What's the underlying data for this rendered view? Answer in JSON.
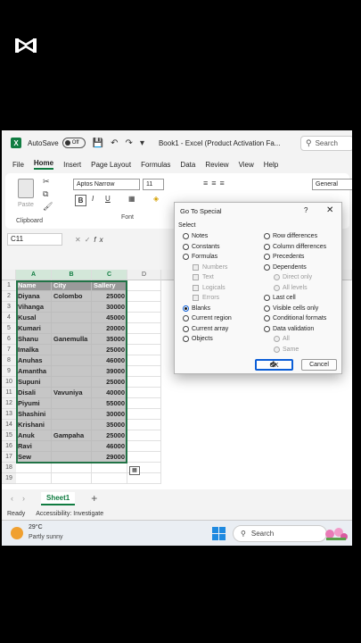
{
  "titlebar": {
    "autosave_label": "AutoSave",
    "autosave_state": "Off",
    "doc_title": "Book1 - Excel (Product Activation Fa...",
    "search_placeholder": "Search"
  },
  "menu": [
    "File",
    "Home",
    "Insert",
    "Page Layout",
    "Formulas",
    "Data",
    "Review",
    "View",
    "Help"
  ],
  "active_menu": "Home",
  "ribbon": {
    "paste_label": "Paste",
    "clipboard_label": "Clipboard",
    "font_name": "Aptos Narrow",
    "font_size": "11",
    "font_label": "Font",
    "bold": "B",
    "italic": "I",
    "underline": "U",
    "number_format": "General"
  },
  "formula": {
    "namebox": "C11",
    "fx": "fx"
  },
  "grid": {
    "columns": [
      "A",
      "B",
      "C",
      "D"
    ],
    "rows": [
      "1",
      "2",
      "3",
      "4",
      "5",
      "6",
      "7",
      "8",
      "9",
      "10",
      "11",
      "12",
      "13",
      "14",
      "15",
      "16",
      "17",
      "18",
      "19"
    ],
    "headers": [
      "Name",
      "City",
      "Sallery"
    ],
    "data": [
      [
        "Diyana",
        "Colombo",
        "25000"
      ],
      [
        "Vihanga",
        "",
        "30000"
      ],
      [
        "Kusal",
        "",
        "45000"
      ],
      [
        "Kumari",
        "",
        "20000"
      ],
      [
        "Shanu",
        "Ganemulla",
        "35000"
      ],
      [
        "Imalka",
        "",
        "25000"
      ],
      [
        "Anuhas",
        "",
        "46000"
      ],
      [
        "Amantha",
        "",
        "39000"
      ],
      [
        "Supuni",
        "",
        "25000"
      ],
      [
        "Disali",
        "Vavuniya",
        "40000"
      ],
      [
        "Piyumi",
        "",
        "55000"
      ],
      [
        "Shashini",
        "",
        "30000"
      ],
      [
        "Krishani",
        "",
        "35000"
      ],
      [
        "Anuk",
        "Gampaha",
        "25000"
      ],
      [
        "Ravi",
        "",
        "46000"
      ],
      [
        "Sew",
        "",
        "29000"
      ]
    ]
  },
  "sheet": {
    "tab": "Sheet1",
    "status": "Ready",
    "accessibility": "Accessibility: Investigate"
  },
  "taskbar": {
    "temp": "29°C",
    "condition": "Partly sunny",
    "search": "Search"
  },
  "dialog": {
    "title": "Go To Special",
    "help": "?",
    "close": "✕",
    "select_label": "Select",
    "left_options": [
      "Notes",
      "Constants",
      "Formulas",
      "Numbers",
      "Text",
      "Logicals",
      "Errors",
      "Blanks",
      "Current region",
      "Current array",
      "Objects"
    ],
    "right_options": [
      "Row differences",
      "Column differences",
      "Precedents",
      "Dependents",
      "Direct only",
      "All levels",
      "Last cell",
      "Visible cells only",
      "Conditional formats",
      "Data validation",
      "All",
      "Same"
    ],
    "selected": "Blanks",
    "ok": "OK",
    "cancel": "Cancel"
  }
}
